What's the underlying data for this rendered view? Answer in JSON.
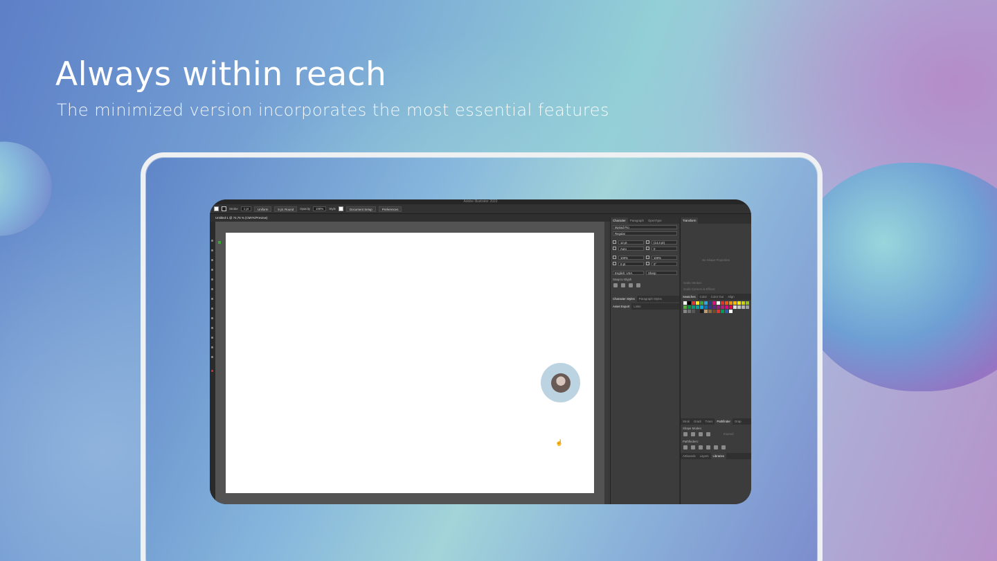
{
  "hero": {
    "title": "Always within reach",
    "subtitle": "The minimized version incorporates the most essential features"
  },
  "app": {
    "window_title": "Adobe Illustrator 2023",
    "control_bar": {
      "stroke_label": "Stroke",
      "stroke_value": "1 pt",
      "profile": "Uniform",
      "brush": "5 pt. Round",
      "opacity_label": "Opacity",
      "opacity_value": "100%",
      "style_label": "Style",
      "doc_setup": "Document Setup",
      "preferences": "Preferences"
    },
    "document_tab": "Untitled-1 @ 74,76 % (CMYK/Preview)",
    "character_panel": {
      "tabs": [
        "Character",
        "Paragraph",
        "OpenType"
      ],
      "font_family": "Myriad Pro",
      "font_style": "Regular",
      "font_size": "12 pt",
      "leading": "(14,4 pt)",
      "kerning": "Auto",
      "tracking": "0",
      "vscale": "100%",
      "hscale": "100%",
      "baseline": "0 pt",
      "rotation": "0°",
      "language": "English: USA",
      "antialias": "Sharp",
      "snap_label": "Snap to Glyph"
    },
    "styles_tabs": [
      "Character Styles",
      "Paragraph Styles"
    ],
    "asset_tabs": [
      "Asset Export",
      "Links"
    ],
    "transform_panel": {
      "tab": "Transform",
      "empty_text": "No Shape Properties",
      "scale_strokes": "Scale Strokes",
      "scale_corners": "Scale Corners & Effects"
    },
    "swatch_tabs": [
      "Swatches",
      "Color",
      "Color Gui",
      "Align"
    ],
    "bottom_tabs": [
      "Strok",
      "Gradi",
      "Trans",
      "Pathfinder",
      "Grap"
    ],
    "pathfinder": {
      "shape_modes": "Shape Modes:",
      "expand": "Expand",
      "pathfinders": "Pathfinders:"
    },
    "footer_tabs": [
      "Artboards",
      "Layers",
      "Libraries"
    ],
    "swatches": [
      "#ffffff",
      "#000000",
      "#e5322d",
      "#f7ea13",
      "#3aaa35",
      "#2fa8e0",
      "#253c8e",
      "#e50d7e",
      "#ffffff",
      "#e4322d",
      "#ea5b0c",
      "#f39200",
      "#fbba00",
      "#ffed00",
      "#cbd400",
      "#95c11f",
      "#52ae32",
      "#00963f",
      "#009b7b",
      "#00a19a",
      "#00a9e0",
      "#0078bf",
      "#2e3b8e",
      "#662483",
      "#951b81",
      "#b81c7d",
      "#e5007e",
      "#e7004c",
      "#dddddd",
      "#c6c6c6",
      "#b2b2b2",
      "#9d9d9d",
      "#878787",
      "#706f6f",
      "#575756",
      "#3c3c3b",
      "#1d1d1b",
      "#be9c6b",
      "#8f6b3b",
      "#6e4b2a",
      "#e4322d",
      "#009b4e",
      "#2d5ba8",
      "#ffffff"
    ]
  }
}
